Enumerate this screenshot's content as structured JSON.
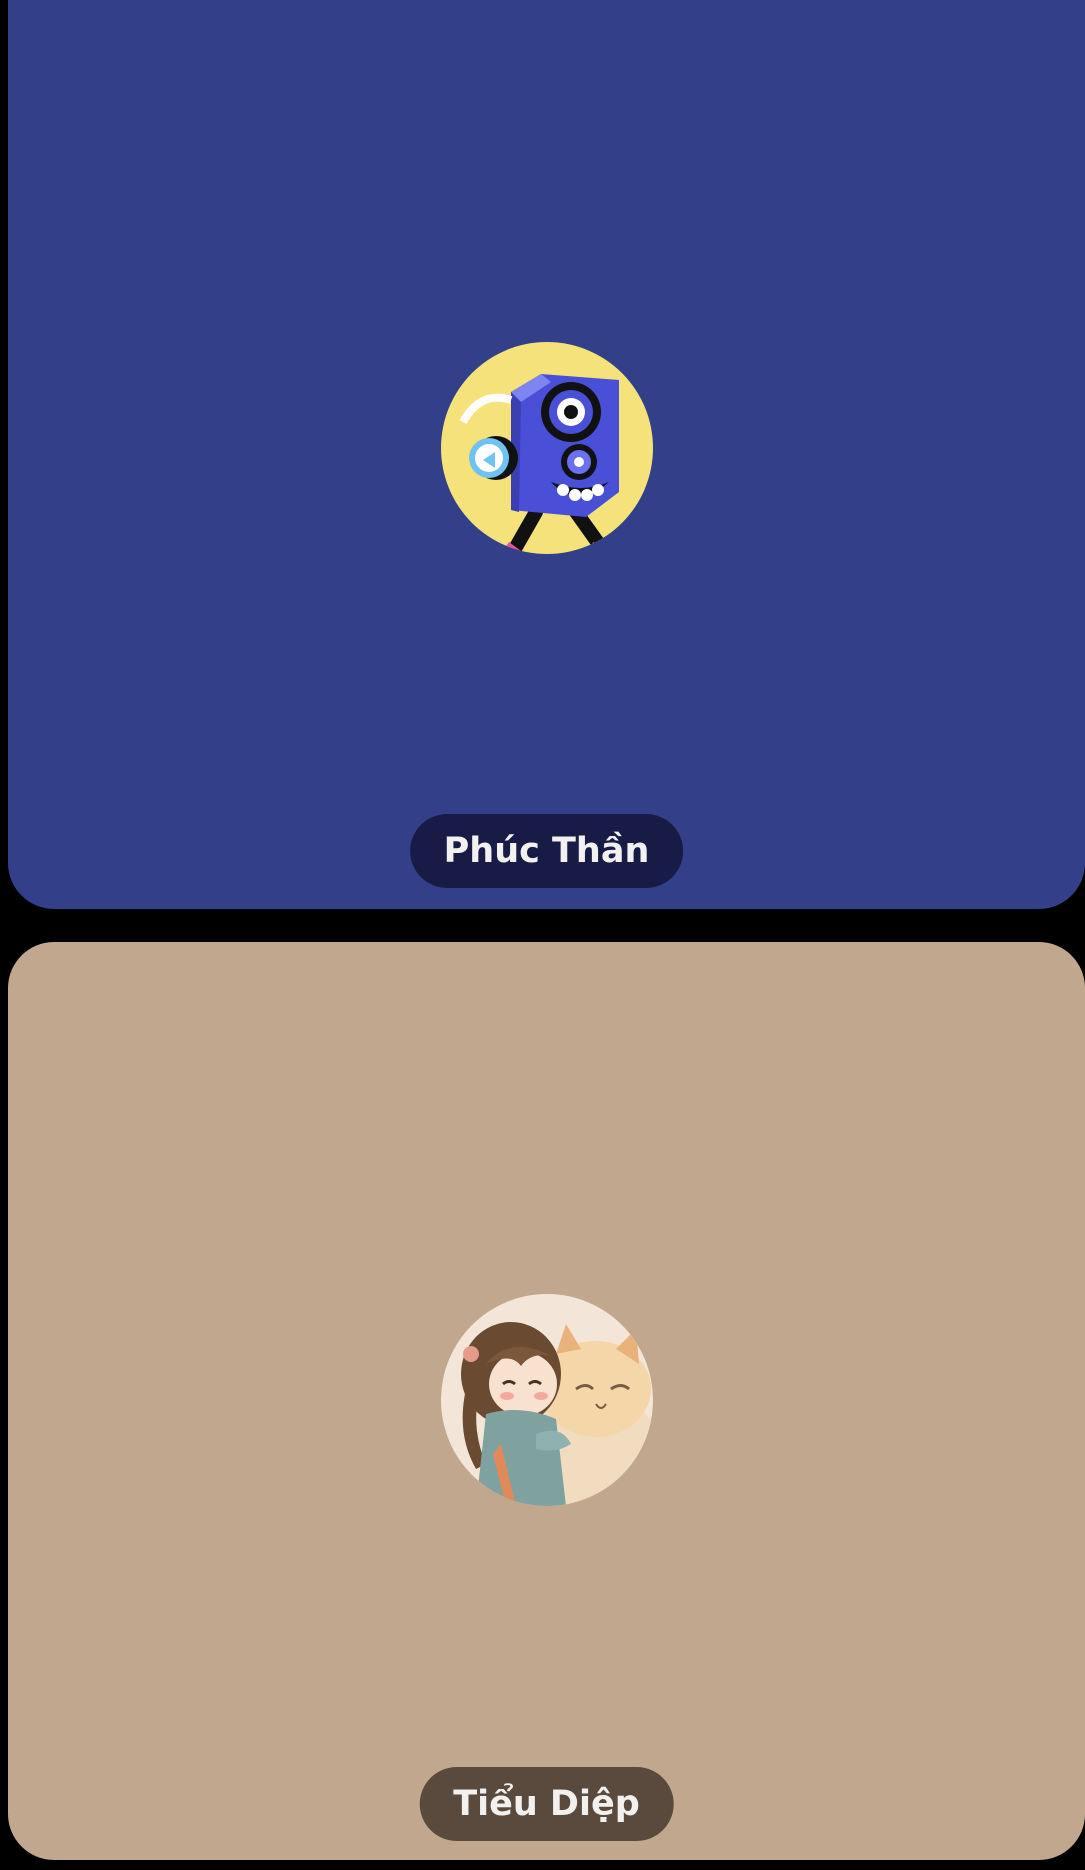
{
  "participants": [
    {
      "name": "Phúc Thần",
      "tile_color": "#333f88",
      "label_color": "#171b45",
      "avatar": {
        "icon": "speaker-mascot-icon",
        "background": "#f5e27a"
      }
    },
    {
      "name": "Tiểu Diệp",
      "tile_color": "#c2a78f",
      "label_color": "#5a4a3e",
      "avatar": {
        "icon": "girl-hugging-cat-icon",
        "background": "#f3e6d8"
      }
    }
  ]
}
